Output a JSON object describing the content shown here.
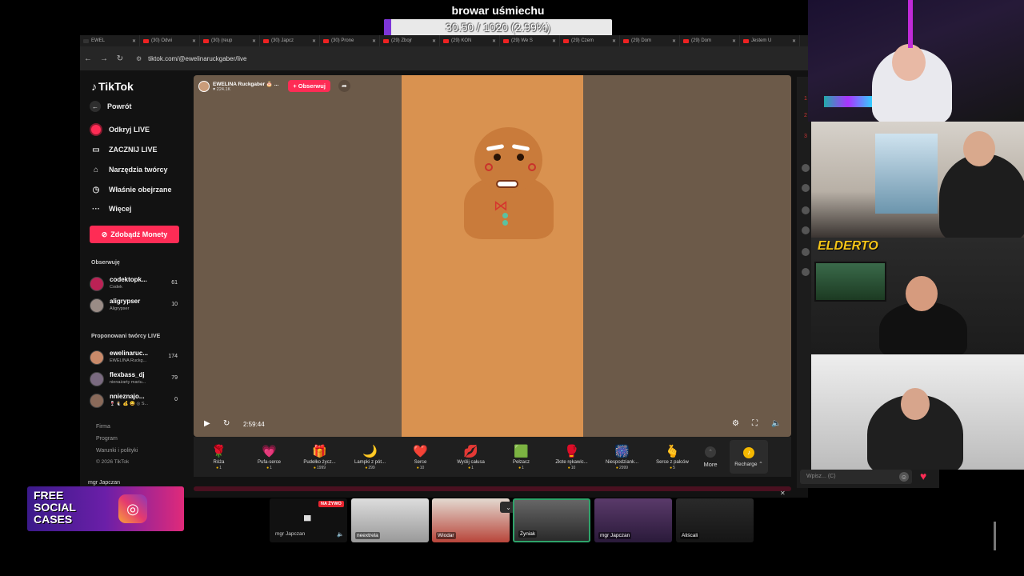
{
  "goal": {
    "title": "browar uśmiechu",
    "progress_text": "30.50 / 1020 (2.99%)",
    "progress_fraction": 0.0299,
    "fill_color": "#7d35d8"
  },
  "browser": {
    "tabs": [
      {
        "label": "EWEL",
        "icon": "tiktok"
      },
      {
        "label": "(30) Odwi",
        "icon": "youtube"
      },
      {
        "label": "(30) (reup",
        "icon": "youtube"
      },
      {
        "label": "(30) Japcz",
        "icon": "youtube"
      },
      {
        "label": "(30) Prone",
        "icon": "youtube"
      },
      {
        "label": "(29) Zbojr",
        "icon": "youtube"
      },
      {
        "label": "(29) KON",
        "icon": "youtube"
      },
      {
        "label": "(29) We S",
        "icon": "youtube"
      },
      {
        "label": "(29) Czem",
        "icon": "youtube"
      },
      {
        "label": "(29) Dom",
        "icon": "youtube"
      },
      {
        "label": "(29) Dom",
        "icon": "youtube"
      },
      {
        "label": "Jestem U",
        "icon": "youtube"
      }
    ],
    "url": "tiktok.com/@ewelinaruckgaber/live"
  },
  "sidebar": {
    "logo": "TikTok",
    "back_label": "Powrót",
    "items": [
      {
        "label": "Odkryj LIVE",
        "icon": "live-icon"
      },
      {
        "label": "ZACZNIJ LIVE",
        "icon": "camera-icon"
      },
      {
        "label": "Narzędzia twórcy",
        "icon": "home-icon"
      },
      {
        "label": "Właśnie obejrzane",
        "icon": "history-icon"
      },
      {
        "label": "Więcej",
        "icon": "more-icon"
      }
    ],
    "coins_button": "Zdobądź Monety",
    "following_title": "Obserwuję",
    "following": [
      {
        "name": "codektopk...",
        "sub": "Codek",
        "count": "61"
      },
      {
        "name": "aligrypser",
        "sub": "Aligrypser",
        "count": "10"
      }
    ],
    "suggested_title": "Proponowani twórcy LIVE",
    "suggested": [
      {
        "name": "ewelinaruc...",
        "sub": "EWELINA Ruckg...",
        "count": "174"
      },
      {
        "name": "flexbass_dj",
        "sub": "nienażarty mariu...",
        "count": "79"
      },
      {
        "name": "nnieznajo...",
        "sub": "🍷 🐧 💰 😀 ◎ S...",
        "count": "0"
      }
    ],
    "footer": [
      "Firma",
      "Program",
      "Warunki i polityki",
      "© 2026 TikTok"
    ]
  },
  "live": {
    "host_name": "EWELINA Ruckgaber 🎂 ...",
    "host_likes": "♥ 224.1K",
    "follow_label": "+ Obserwuj",
    "time": "2:59:44"
  },
  "gifts": [
    {
      "name": "Róża",
      "price": "1",
      "icon": "🌹"
    },
    {
      "name": "Pufa-serce",
      "price": "1",
      "icon": "💗"
    },
    {
      "name": "Pudełko życz...",
      "price": "1999",
      "icon": "🎁"
    },
    {
      "name": "Lampki z pót...",
      "price": "299",
      "icon": "🌙"
    },
    {
      "name": "Serce",
      "price": "10",
      "icon": "❤️"
    },
    {
      "name": "Wyślij całusa",
      "price": "1",
      "icon": "💋"
    },
    {
      "name": "Pełzacz",
      "price": "1",
      "icon": "🟩"
    },
    {
      "name": "Złote rękawic...",
      "price": "10",
      "icon": "🥊"
    },
    {
      "name": "Niespodziank...",
      "price": "2999",
      "icon": "🎆"
    },
    {
      "name": "Serce z palców",
      "price": "5",
      "icon": "🫰"
    }
  ],
  "gifts_more": "More",
  "recharge": "Recharge ⌃",
  "chat": {
    "placeholder": "Wpisz... (C)"
  },
  "overlay": {
    "elder_logo": "ELDERTO",
    "ad_lines": [
      "FREE",
      "SOCIAL",
      "CASES"
    ],
    "ad_user": "mgr Japczan"
  },
  "call": {
    "live_badge": "NA ŻYWO",
    "self_name": "mgr Japczan",
    "participants": [
      "neextrela",
      "Wiodar",
      "Żyniak",
      "mgr Japczan",
      "Aliścali"
    ]
  }
}
